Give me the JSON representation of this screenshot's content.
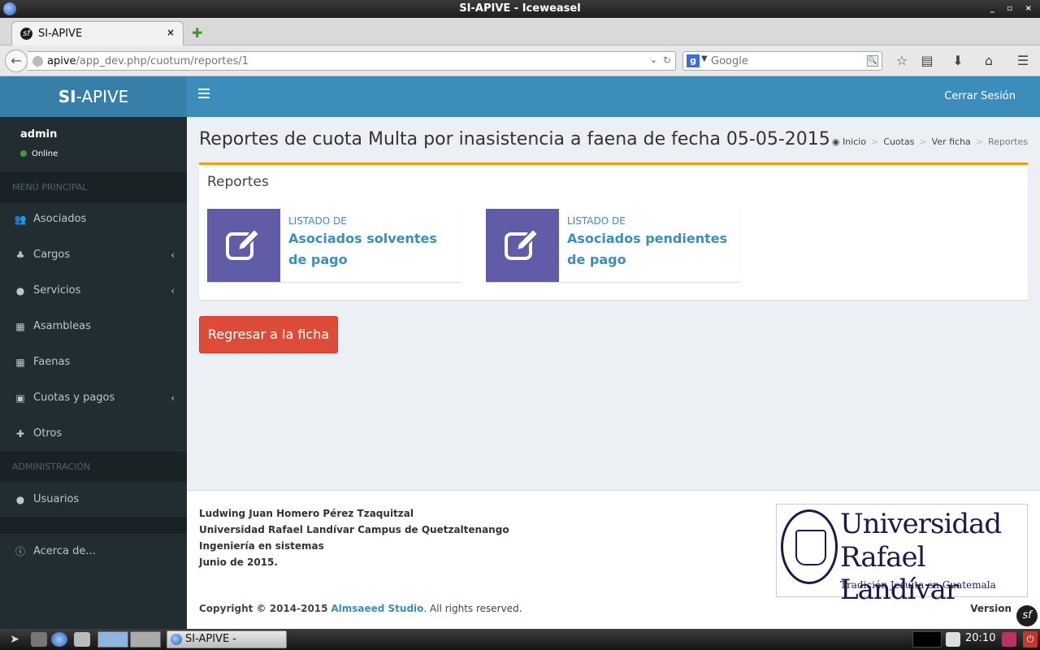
{
  "window": {
    "title": "SI-APIVE - Iceweasel",
    "controls": "_ ▫ ×"
  },
  "browser": {
    "tab_title": "SI-APIVE",
    "tab_close": "×",
    "new_tab": "✚",
    "url_host": "apive",
    "url_path": "/app_dev.php/cuotum/reportes/1",
    "search_placeholder": "Google",
    "search_engine": "g"
  },
  "header": {
    "logo_bold": "SI",
    "logo_rest": "-APIVE",
    "logout": "Cerrar Sesión"
  },
  "sidebar": {
    "user_name": "admin",
    "user_status": "Online",
    "main_header": "MENÚ PRINCIPAL",
    "items": [
      {
        "label": "Asociados",
        "icon": "users-icon",
        "glyph": "👥"
      },
      {
        "label": "Cargos",
        "icon": "sitemap-icon",
        "glyph": "♣",
        "chevron": "‹"
      },
      {
        "label": "Servicios",
        "icon": "tint-icon",
        "glyph": "●",
        "chevron": "‹"
      },
      {
        "label": "Asambleas",
        "icon": "calendar-icon",
        "glyph": "▦"
      },
      {
        "label": "Faenas",
        "icon": "calendar-icon",
        "glyph": "▦"
      },
      {
        "label": "Cuotas y pagos",
        "icon": "money-icon",
        "glyph": "▣",
        "chevron": "‹"
      },
      {
        "label": "Otros",
        "icon": "plus-icon",
        "glyph": "✚"
      }
    ],
    "admin_header": "ADMINISTRACIÓN",
    "admin_items": [
      {
        "label": "Usuarios",
        "icon": "user-icon",
        "glyph": "●"
      }
    ],
    "about": {
      "label": "Acerca de...",
      "icon": "info-icon",
      "glyph": "ⓘ"
    }
  },
  "content": {
    "title": "Reportes de cuota Multa por inasistencia a faena de fecha 05-05-2015",
    "breadcrumb": [
      "Inicio",
      "Cuotas",
      "Ver ficha",
      "Reportes"
    ],
    "breadcrumb_icon": "dashboard-icon",
    "box_title": "Reportes",
    "reports": [
      {
        "small": "LISTADO DE",
        "big": "Asociados solventes de pago",
        "icon": "edit-icon",
        "color": "#605ca8"
      },
      {
        "small": "LISTADO DE",
        "big": "Asociados pendientes de pago",
        "icon": "edit-icon",
        "color": "#605ca8"
      }
    ],
    "back_button": "Regresar a la ficha",
    "accent_colors": {
      "box_border": "#f39c12",
      "header": "#3c8dbc",
      "danger": "#dd4b39"
    }
  },
  "footer": {
    "credits": [
      "Ludwing Juan Homero Pérez Tzaquitzal",
      "Universidad Rafael Landívar Campus de Quetzaltenango",
      "Ingeniería en sistemas",
      "Junio de 2015."
    ],
    "university_line1": "Universidad",
    "university_line2": "Rafael Landívar",
    "university_tagline": "Tradición Jesuita en Guatemala",
    "copyright_prefix": "Copyright © 2014-2015",
    "copyright_studio": "Almsaeed Studio",
    "copyright_suffix": ". All rights reserved.",
    "version_label": "Version",
    "sf_badge": "sf"
  },
  "taskbar": {
    "task_label": "SI-APIVE - Icewea...",
    "clock": "20:10"
  }
}
